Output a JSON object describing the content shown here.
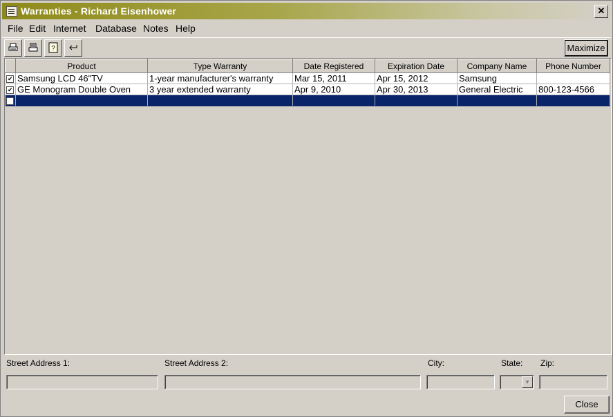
{
  "window": {
    "title": "Warranties - Richard Eisenhower",
    "close_glyph": "✕"
  },
  "menu": [
    "File",
    "Edit",
    "Internet",
    "Database",
    "Notes",
    "Help"
  ],
  "toolbar": {
    "maximize_label": "Maximize"
  },
  "table": {
    "headers": [
      "Product",
      "Type Warranty",
      "Date Registered",
      "Expiration Date",
      "Company Name",
      "Phone Number"
    ],
    "rows": [
      {
        "checked": true,
        "product": "Samsung  LCD 46\"TV",
        "type": "1-year manufacturer's warranty",
        "registered": "Mar 15, 2011",
        "expiration": "Apr 15, 2012",
        "company": "Samsung",
        "phone": ""
      },
      {
        "checked": true,
        "product": "GE Monogram Double Oven",
        "type": "3 year extended warranty",
        "registered": "Apr 9, 2010",
        "expiration": "Apr 30, 2013",
        "company": "General Electric",
        "phone": "800-123-4566"
      },
      {
        "checked": false,
        "product": "",
        "type": "",
        "registered": "",
        "expiration": "",
        "company": "",
        "phone": ""
      }
    ]
  },
  "address": {
    "street1_label": "Street Address 1:",
    "street2_label": "Street Address 2:",
    "city_label": "City:",
    "state_label": "State:",
    "zip_label": "Zip:"
  },
  "footer": {
    "close_label": "Close"
  }
}
